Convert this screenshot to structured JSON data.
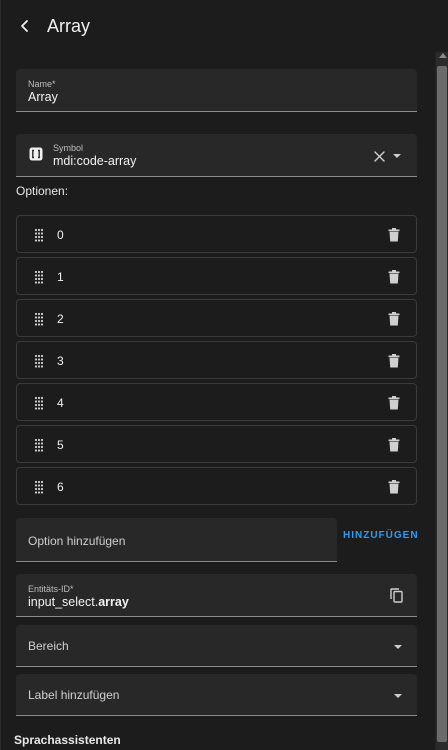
{
  "header": {
    "title": "Array",
    "back_icon": "arrow-left-icon"
  },
  "name_field": {
    "label": "Name*",
    "value": "Array"
  },
  "symbol_field": {
    "label": "Symbol",
    "value": "mdi:code-array",
    "icon": "code-array-icon"
  },
  "options": {
    "title": "Optionen:",
    "items": [
      {
        "label": "0"
      },
      {
        "label": "1"
      },
      {
        "label": "2"
      },
      {
        "label": "3"
      },
      {
        "label": "4"
      },
      {
        "label": "5"
      },
      {
        "label": "6"
      }
    ]
  },
  "add_option": {
    "placeholder": "Option hinzufügen",
    "button_label": "HINZUFÜGEN"
  },
  "entity_field": {
    "label": "Entitäts-ID*",
    "value_prefix": "input_select.",
    "value_suffix": "array"
  },
  "area_select": {
    "label": "Bereich"
  },
  "label_select": {
    "label": "Label hinzufügen"
  },
  "voice_section": {
    "title": "Sprachassistenten"
  },
  "colors": {
    "accent": "#2d9bf0",
    "background": "#1c1c1c",
    "field_bg": "#282828"
  }
}
